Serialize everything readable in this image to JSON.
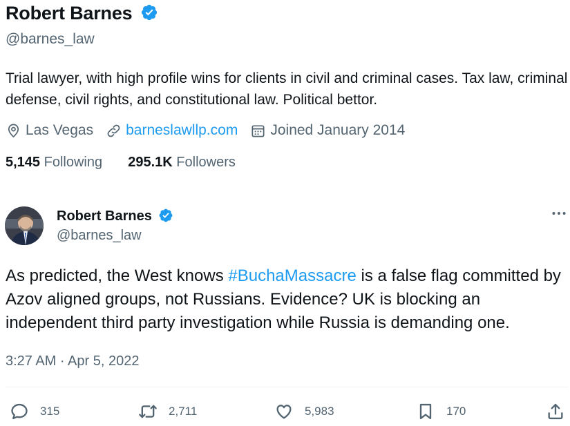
{
  "profile": {
    "name": "Robert Barnes",
    "handle": "@barnes_law",
    "bio": "Trial lawyer, with high profile wins for clients in civil and criminal cases. Tax law, criminal defense, civil rights, and constitutional law. Political bettor.",
    "location": "Las Vegas",
    "website": "barneslawllp.com",
    "joined": "Joined January 2014",
    "following_count": "5,145",
    "following_label": "Following",
    "followers_count": "295.1K",
    "followers_label": "Followers"
  },
  "tweet": {
    "author_name": "Robert Barnes",
    "author_handle": "@barnes_law",
    "text_before": "As predicted, the West knows ",
    "hashtag": "#BuchaMassacre",
    "text_after": " is a false flag committed by Azov aligned groups, not Russians. Evidence? UK is blocking an independent third party investigation while Russia is demanding one.",
    "timestamp": "3:27 AM · Apr 5, 2022",
    "replies": "315",
    "retweets": "2,711",
    "likes": "5,983",
    "bookmarks": "170"
  },
  "colors": {
    "accent": "#1d9bf0",
    "secondary_text": "#536471",
    "primary_text": "#0f1419"
  },
  "icons": [
    "verified-badge-icon",
    "location-pin-icon",
    "link-icon",
    "calendar-icon",
    "more-icon",
    "reply-icon",
    "retweet-icon",
    "like-icon",
    "bookmark-icon",
    "share-icon"
  ]
}
